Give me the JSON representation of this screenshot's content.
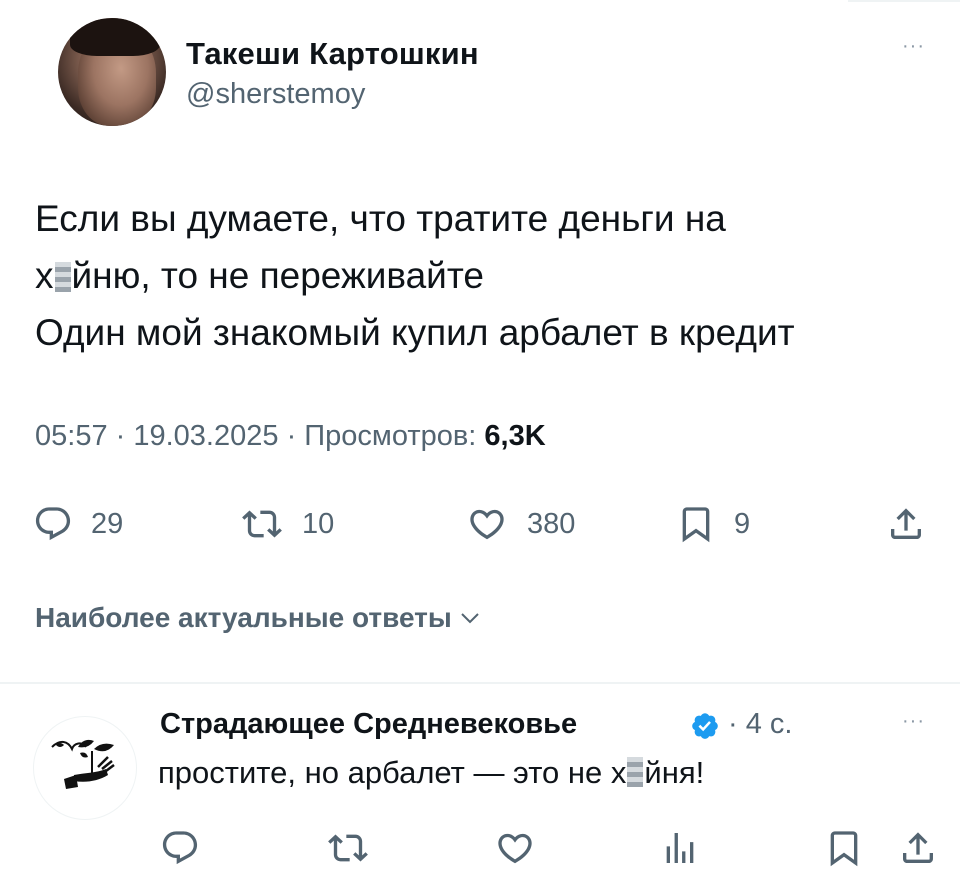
{
  "tweet": {
    "author": {
      "name": "Такеши Картошкин",
      "handle": "@sherstemoy"
    },
    "more": "···",
    "text": {
      "line1": "Если вы думаете, что тратите деньги на",
      "line2_start": "х",
      "line2_end": "йню, то не переживайте",
      "line3": "Один мой знакомый купил арбалет в кредит"
    },
    "meta": {
      "time": "05:57",
      "separator1": " · ",
      "date": "19.03.2025",
      "separator2": " · ",
      "views_label": "Просмотров: ",
      "views_value": "6,3K"
    },
    "actions": {
      "replies": "29",
      "reposts": "10",
      "likes": "380",
      "bookmarks": "9"
    }
  },
  "replies_sort": {
    "label": "Наиболее актуальные ответы"
  },
  "reply": {
    "author": {
      "name": "Страдающее Средневековье",
      "verified": true
    },
    "time": "· 4 с.",
    "more": "···",
    "text": {
      "start": "простите, но арбалет — это не х",
      "end": "йня!"
    }
  },
  "colors": {
    "text": "#0f1419",
    "secondary": "#536471",
    "verified": "#1d9bf0",
    "divider": "#eff3f4"
  },
  "icons": [
    "reply-icon",
    "repost-icon",
    "like-icon",
    "bookmark-icon",
    "share-icon",
    "views-icon",
    "verified-badge-icon",
    "chevron-down-icon"
  ]
}
